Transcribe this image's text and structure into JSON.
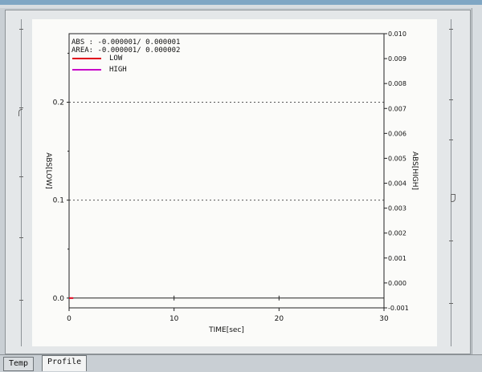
{
  "tabs": [
    {
      "label": "Temp",
      "active": false
    },
    {
      "label": "Profile",
      "active": true
    }
  ],
  "legend": {
    "abs_line": "ABS : -0.000001/ 0.000001",
    "area_line": "AREA: -0.000001/ 0.000002",
    "items": [
      {
        "label": "LOW",
        "color": "#e0001b"
      },
      {
        "label": "HIGH",
        "color": "#c800c8"
      }
    ]
  },
  "chart_data": {
    "type": "line",
    "xlabel": "TIME[sec]",
    "ylabel": "ABS[LOW]",
    "y2label": "ABS[HIGH]",
    "xlim": [
      0,
      30
    ],
    "ylim": [
      -0.01,
      0.27
    ],
    "y2lim": [
      -0.001,
      0.01
    ],
    "x_ticks": [
      "0",
      "10",
      "20",
      "30"
    ],
    "x_tick_values": [
      0,
      10,
      20,
      30
    ],
    "y_ticks": [
      "0.0",
      "0.1",
      "0.2"
    ],
    "y_tick_values": [
      0,
      0.1,
      0.2
    ],
    "y2_ticks": [
      "-0.001",
      "0.000",
      "0.001",
      "0.002",
      "0.003",
      "0.004",
      "0.005",
      "0.006",
      "0.007",
      "0.008",
      "0.009",
      "0.010"
    ],
    "y2_tick_values": [
      -0.001,
      0,
      0.001,
      0.002,
      0.003,
      0.004,
      0.005,
      0.006,
      0.007,
      0.008,
      0.009,
      0.01
    ],
    "grid_y": [
      0.1,
      0.2
    ],
    "series": [
      {
        "name": "LOW",
        "color": "#e0001b",
        "x": [
          0,
          0.4
        ],
        "y": [
          0,
          0
        ]
      },
      {
        "name": "HIGH",
        "color": "#c800c8",
        "x": [],
        "y": []
      }
    ]
  }
}
